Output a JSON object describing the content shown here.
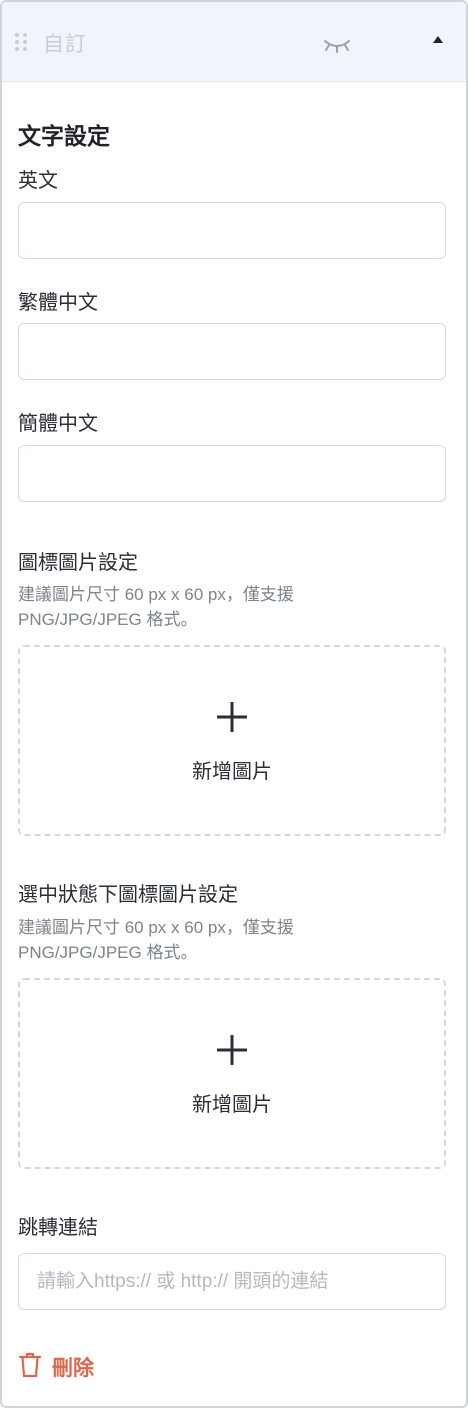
{
  "header": {
    "title": "自訂",
    "drag_icon": "drag-handle-icon",
    "visibility_icon": "eye-closed-icon",
    "collapse_icon": "caret-up-icon"
  },
  "text_settings": {
    "title": "文字設定",
    "fields": [
      {
        "label": "英文",
        "value": "",
        "placeholder": ""
      },
      {
        "label": "繁體中文",
        "value": "",
        "placeholder": ""
      },
      {
        "label": "簡體中文",
        "value": "",
        "placeholder": ""
      }
    ]
  },
  "icon_image": {
    "title": "圖標圖片設定",
    "hint": "建議圖片尺寸 60 px x 60 px，僅支援 PNG/JPG/JPEG 格式。",
    "upload_label": "新增圖片",
    "upload_icon": "plus-icon"
  },
  "selected_icon_image": {
    "title": "選中狀態下圖標圖片設定",
    "hint": "建議圖片尺寸 60 px x 60 px，僅支援 PNG/JPG/JPEG 格式。",
    "upload_label": "新增圖片",
    "upload_icon": "plus-icon"
  },
  "link": {
    "label": "跳轉連結",
    "value": "",
    "placeholder": "請輸入https:// 或 http:// 開頭的連結"
  },
  "delete": {
    "label": "刪除",
    "icon": "trash-icon",
    "color": "#d9694e"
  },
  "colors": {
    "header_bg": "#f1f4fd",
    "border": "#d5d9e0",
    "hint_text": "#7d838d",
    "danger": "#d9694e"
  }
}
